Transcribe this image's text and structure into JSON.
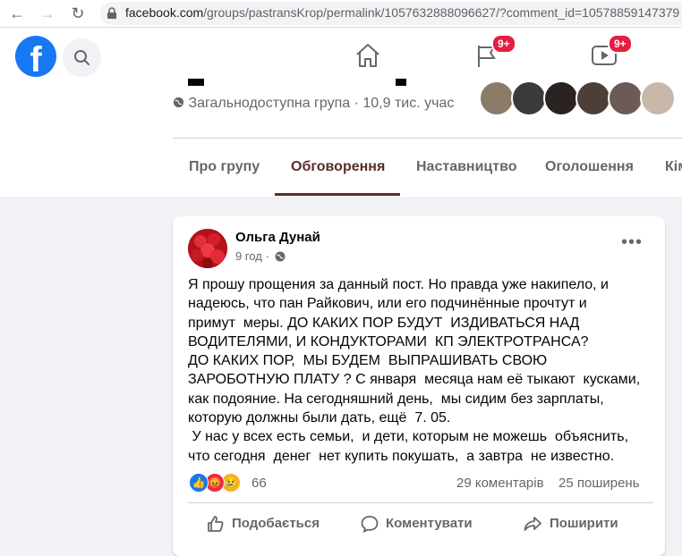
{
  "browser": {
    "url_host": "facebook.com",
    "url_path": "/groups/pastransKrop/permalink/1057632888096627/?comment_id=10578859147379"
  },
  "header": {
    "logo_text": "f",
    "groups_badge": "9+",
    "watch_badge": "9+"
  },
  "group": {
    "privacy_line": "Загальнодоступна група · 10,9 тис. учас",
    "tabs": [
      {
        "label": "Про групу"
      },
      {
        "label": "Обговорення"
      },
      {
        "label": "Наставництво"
      },
      {
        "label": "Оголошення"
      },
      {
        "label": "Кім"
      }
    ],
    "active_tab_color": "#5a2d2d"
  },
  "post": {
    "author": "Ольга Дунай",
    "time": "9 год ·",
    "more": "•••",
    "text": "Я прошу прощения за данный пост. Но правда уже накипело, и\nнадеюсь, что пан Райкович, или его подчинённые прочтут и\nпримут  меры. ДО КАКИХ ПОР БУДУТ  ИЗДИВАТЬСЯ НАД\nВОДИТЕЛЯМИ, И КОНДУКТОРАМИ  КП ЭЛЕКТРОТРАНСА?\nДО КАКИХ ПОР,  МЫ БУДЕМ  ВЫПРАШИВАТЬ СВОЮ\nЗАРОБОТНУЮ ПЛАТУ ? С января  месяца нам её тыкают  кусками,\nкак подояние. На сегодняшний день,  мы сидим без зарплаты,\nкоторую должны были дать, ещё  7. 05.\n У нас у всех есть семьи,  и дети, которым не можешь  объяснить,\nчто сегодня  денег  нет купить покушать,  а завтра  не известно.",
    "reactions_count": "66",
    "comments": "29 коментарів",
    "shares": "25 поширень",
    "actions": {
      "like": "Подобається",
      "comment": "Коментувати",
      "share": "Поширити"
    }
  },
  "colors": {
    "fb_blue": "#1877f2",
    "badge_red": "#e41e3f",
    "secondary_text": "#65676b"
  }
}
